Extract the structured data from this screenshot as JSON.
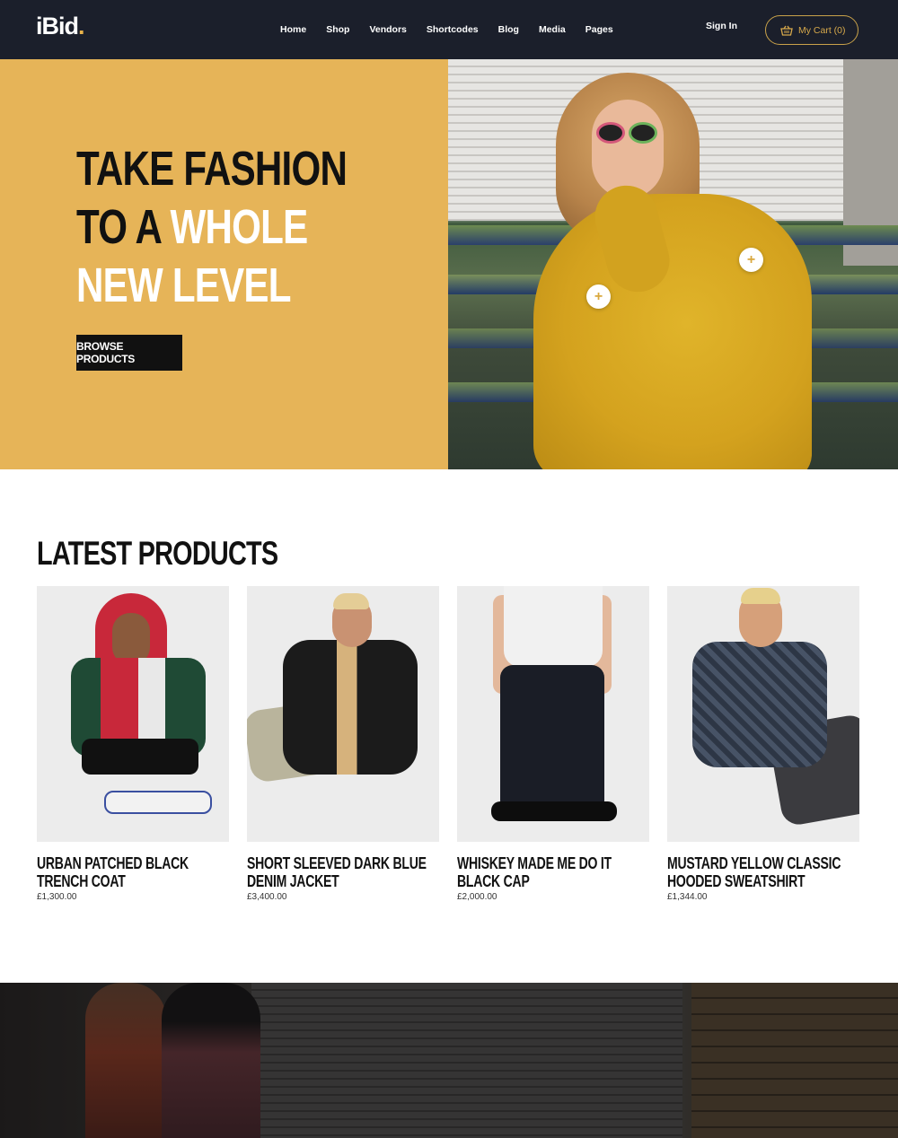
{
  "header": {
    "logo_text": "iBid",
    "logo_dot": ".",
    "nav": [
      "Home",
      "Shop",
      "Vendors",
      "Shortcodes",
      "Blog",
      "Media",
      "Pages"
    ],
    "sign_in": "Sign In",
    "cart_label": "My Cart (0)",
    "cart_icon": "basket-icon"
  },
  "hero": {
    "title_line1": "TAKE FASHION",
    "title_line2_dark": "TO A",
    "title_line2_light": "WHOLE",
    "title_line3": "NEW LEVEL",
    "button": "BROWSE PRODUCTS",
    "hotspot_symbol": "+"
  },
  "latest": {
    "title": "LATEST PRODUCTS",
    "products": [
      {
        "name": "URBAN PATCHED BLACK TRENCH COAT",
        "price": "£1,300.00"
      },
      {
        "name": "SHORT SLEEVED DARK BLUE DENIM JACKET",
        "price": "£3,400.00"
      },
      {
        "name": "WHISKEY MADE ME DO IT BLACK CAP",
        "price": "£2,000.00"
      },
      {
        "name": "MUSTARD YELLOW CLASSIC HOODED SWEATSHIRT",
        "price": "£1,344.00"
      }
    ]
  },
  "colors": {
    "header_bg": "#1b1f2b",
    "accent": "#e6b458",
    "cart_border": "#c9a24a"
  }
}
